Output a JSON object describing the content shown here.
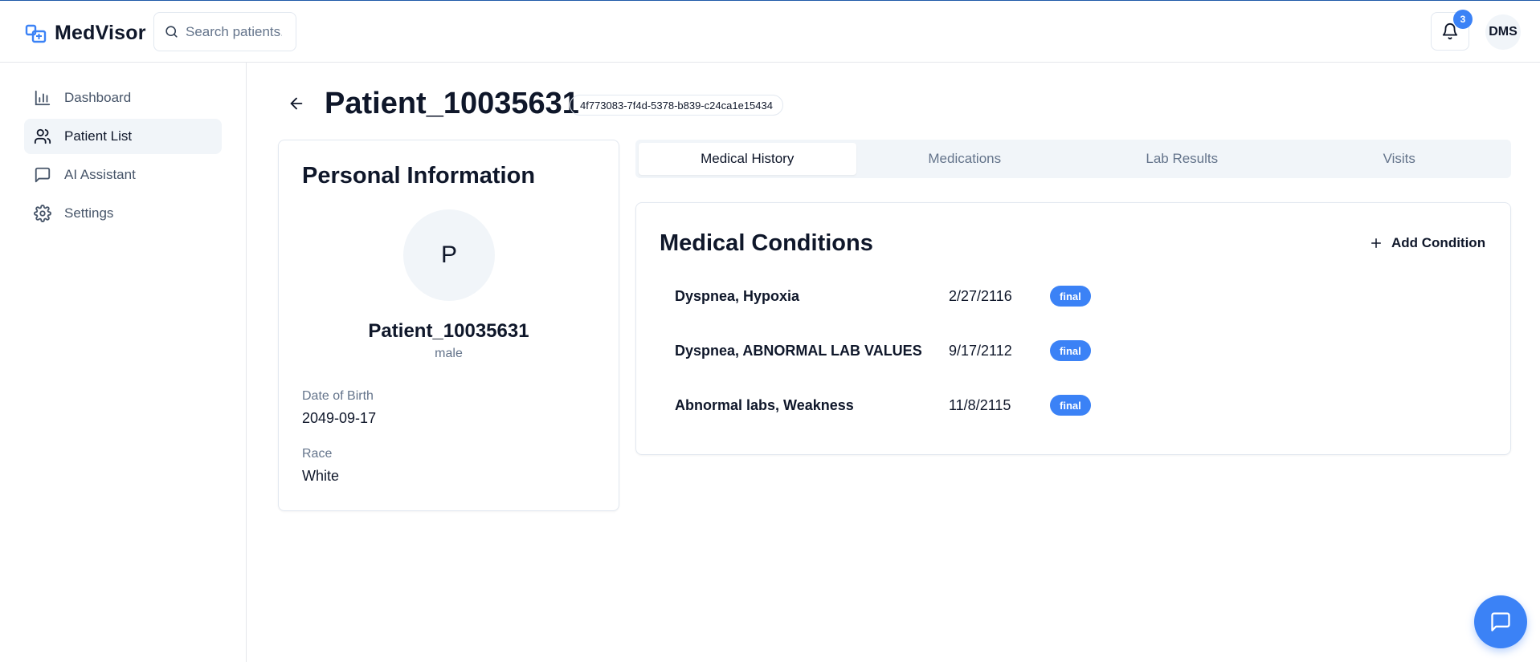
{
  "app": {
    "name": "MedVisor"
  },
  "search": {
    "placeholder": "Search patients..."
  },
  "notifications": {
    "count": "3"
  },
  "user": {
    "initials": "DMS"
  },
  "sidebar": {
    "items": [
      {
        "label": "Dashboard",
        "icon": "bar-chart-icon"
      },
      {
        "label": "Patient List",
        "icon": "users-icon",
        "active": true
      },
      {
        "label": "AI Assistant",
        "icon": "message-square-icon"
      },
      {
        "label": "Settings",
        "icon": "gear-icon"
      }
    ]
  },
  "patient": {
    "title": "Patient_10035631",
    "id": "4f773083-7f4d-5378-b839-c24ca1e15434",
    "avatar_initial": "P",
    "name": "Patient_10035631",
    "gender": "male",
    "dob_label": "Date of Birth",
    "dob": "2049-09-17",
    "race_label": "Race",
    "race": "White"
  },
  "personal_card": {
    "title": "Personal Information"
  },
  "tabs": [
    {
      "label": "Medical History",
      "active": true
    },
    {
      "label": "Medications"
    },
    {
      "label": "Lab Results"
    },
    {
      "label": "Visits"
    }
  ],
  "conditions": {
    "title": "Medical Conditions",
    "add_label": "Add Condition",
    "rows": [
      {
        "name": "Dyspnea, Hypoxia",
        "date": "2/27/2116",
        "status": "final"
      },
      {
        "name": "Dyspnea, ABNORMAL LAB VALUES",
        "date": "9/17/2112",
        "status": "final"
      },
      {
        "name": "Abnormal labs, Weakness",
        "date": "11/8/2115",
        "status": "final"
      }
    ]
  },
  "colors": {
    "accent": "#3b82f6",
    "brand_line": "#1e5aa8"
  }
}
